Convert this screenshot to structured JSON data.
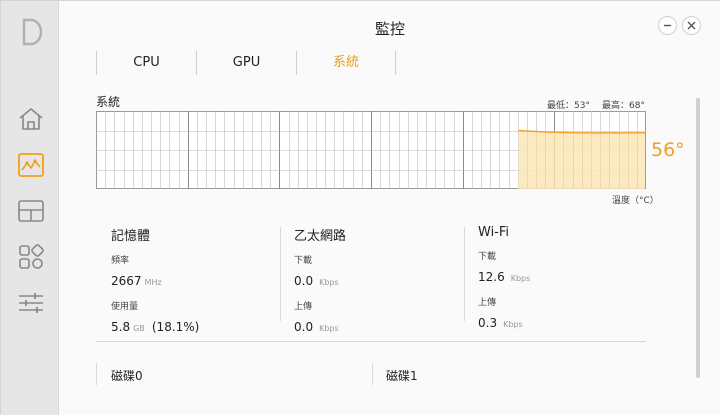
{
  "window": {
    "title": "監控"
  },
  "tabs": [
    {
      "label": "CPU",
      "active": false
    },
    {
      "label": "GPU",
      "active": false
    },
    {
      "label": "系統",
      "active": true
    }
  ],
  "system": {
    "label": "系統",
    "min_label": "最低：53°",
    "max_label": "最高：68°",
    "current_temp": "56°",
    "unit_label": "溫度（°C）",
    "temps": [
      57.5,
      57.2,
      57.0,
      56.8,
      56.6,
      56.4,
      56.3,
      56.2,
      56.1,
      56.0,
      56.0,
      56.0,
      55.9,
      56.0,
      56.0,
      55.9,
      56.0,
      56.0,
      56.0,
      56.0
    ]
  },
  "memory": {
    "title": "記憶體",
    "freq_label": "頻率",
    "freq_value": "2667",
    "freq_unit": "MHz",
    "usage_label": "使用量",
    "usage_value": "5.8",
    "usage_unit": "GB",
    "usage_percent": "(18.1%)"
  },
  "ethernet": {
    "title": "乙太網路",
    "down_label": "下載",
    "down_value": "0.0",
    "down_unit": "Kbps",
    "up_label": "上傳",
    "up_value": "0.0",
    "up_unit": "Kbps"
  },
  "wifi": {
    "title": "Wi-Fi",
    "down_label": "下載",
    "down_value": "12.6",
    "down_unit": "Kbps",
    "up_label": "上傳",
    "up_value": "0.3",
    "up_unit": "Kbps"
  },
  "disks": [
    {
      "label": "磁碟0"
    },
    {
      "label": "磁碟1"
    }
  ],
  "colors": {
    "accent": "#f0a020",
    "fill": "#fbe6b8"
  },
  "icons": {
    "logo": "d-logo-icon",
    "home": "home-icon",
    "monitor": "monitor-icon",
    "layout": "layout-icon",
    "apps": "apps-icon",
    "settings": "sliders-icon"
  }
}
